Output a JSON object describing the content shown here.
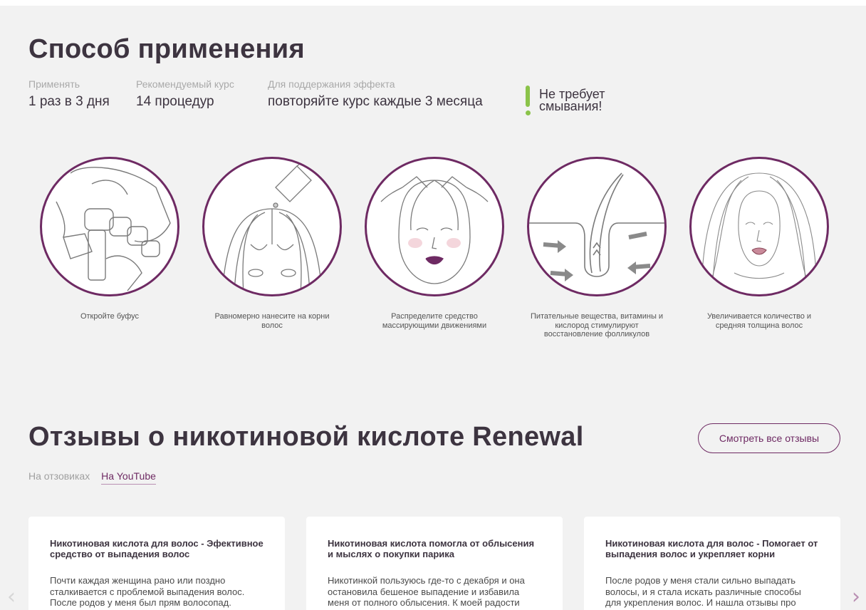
{
  "usage": {
    "title": "Способ применения",
    "specs": [
      {
        "label": "Применять",
        "value": "1 раз в 3 дня"
      },
      {
        "label": "Рекомендуемый курс",
        "value": "14 процедур"
      },
      {
        "label": "Для поддержания эффекта",
        "value": "повторяйте курс каждые 3 месяца"
      }
    ],
    "no_wash": "Не требует смывания!",
    "accent_color": "#8bc34a",
    "steps": [
      {
        "icon": "ampoule-hands-icon",
        "caption": "Откройте буфус"
      },
      {
        "icon": "apply-roots-icon",
        "caption": "Равномерно нанесите на корни волос"
      },
      {
        "icon": "scalp-massage-icon",
        "caption": "Распределите средство массирующими движениями"
      },
      {
        "icon": "hair-follicle-icon",
        "caption": "Питательные вещества, витамины и кислород стимулируют восстановление фолликулов"
      },
      {
        "icon": "voluminous-hair-icon",
        "caption": "Увеличивается количество и средняя толщина волос"
      }
    ],
    "circle_color": "#6e2a63"
  },
  "reviews": {
    "title": "Отзывы о никотиновой кислоте Renewal",
    "all_button": "Смотреть все отзывы",
    "tabs": [
      {
        "label": "На отзовиках",
        "active": false
      },
      {
        "label": "На YouTube",
        "active": true
      }
    ],
    "cards": [
      {
        "title": "Никотиновая кислота для волос - Эфективное средство от выпадения волос",
        "text": "Почти каждая женщина рано или поздно сталкивается с проблемой выпадения волос. После родов у меня был прям волосопад."
      },
      {
        "title": "Никотиновая кислота помогла от облысения и мыслях о покупки парика",
        "text": "Никотинкой пользуюсь где-то с декабря и она остановила бешеное выпадение и избавила меня от полного облысения. К моей радости"
      },
      {
        "title": "Никотиновая кислота для волос - Помогает от выпадения волос и укрепляет корни",
        "text": "После родов у меня стали сильно выпадать волосы, и я стала искать различные способы для укрепления волос. И нашла отзывы про"
      }
    ],
    "prev_arrow": "‹",
    "next_arrow": "›"
  }
}
